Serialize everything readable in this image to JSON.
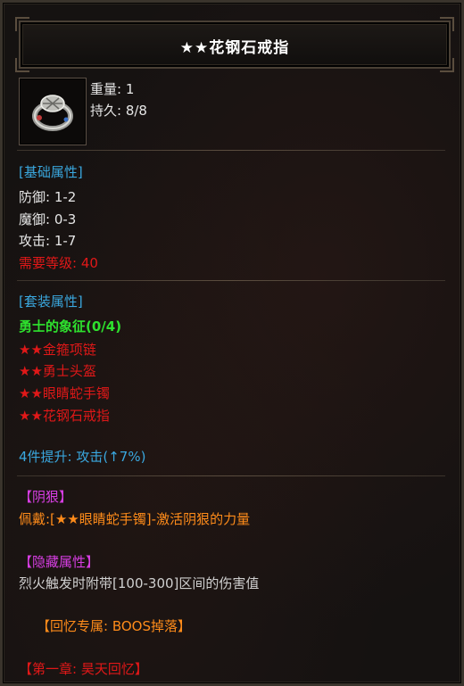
{
  "item": {
    "title": "★★花钢石戒指",
    "icon": "ring-icon",
    "weight_label": "重量: 1",
    "durability_label": "持久: 8/8"
  },
  "basic": {
    "header": "[基础属性]",
    "defense": "防御: 1-2",
    "magic_defense": "魔御: 0-3",
    "attack": "攻击: 1-7",
    "required_level": "需要等级: 40"
  },
  "set": {
    "header": "[套装属性]",
    "name": "勇士的象征(0/4)",
    "pieces": [
      "★★金箍项链",
      "★★勇士头盔",
      "★★眼睛蛇手镯",
      "★★花钢石戒指"
    ],
    "bonus": "4件提升: 攻击(↑7%)"
  },
  "yinhen": {
    "header": "【阴狠】",
    "desc": "佩戴:[★★眼睛蛇手镯]-激活阴狠的力量"
  },
  "hidden": {
    "header": "【隐藏属性】",
    "desc": "烈火触发时附带[100-300]区间的伤害值"
  },
  "memory": {
    "exclusive": "【回忆专属: BOOS掉落】",
    "chapter": "【第一章: 昊天回忆】"
  },
  "colors": {
    "cyan": "#3aa7de",
    "red": "#e01818",
    "green": "#2ee12e",
    "purple": "#d73ee3",
    "orange": "#ff8c1a"
  }
}
